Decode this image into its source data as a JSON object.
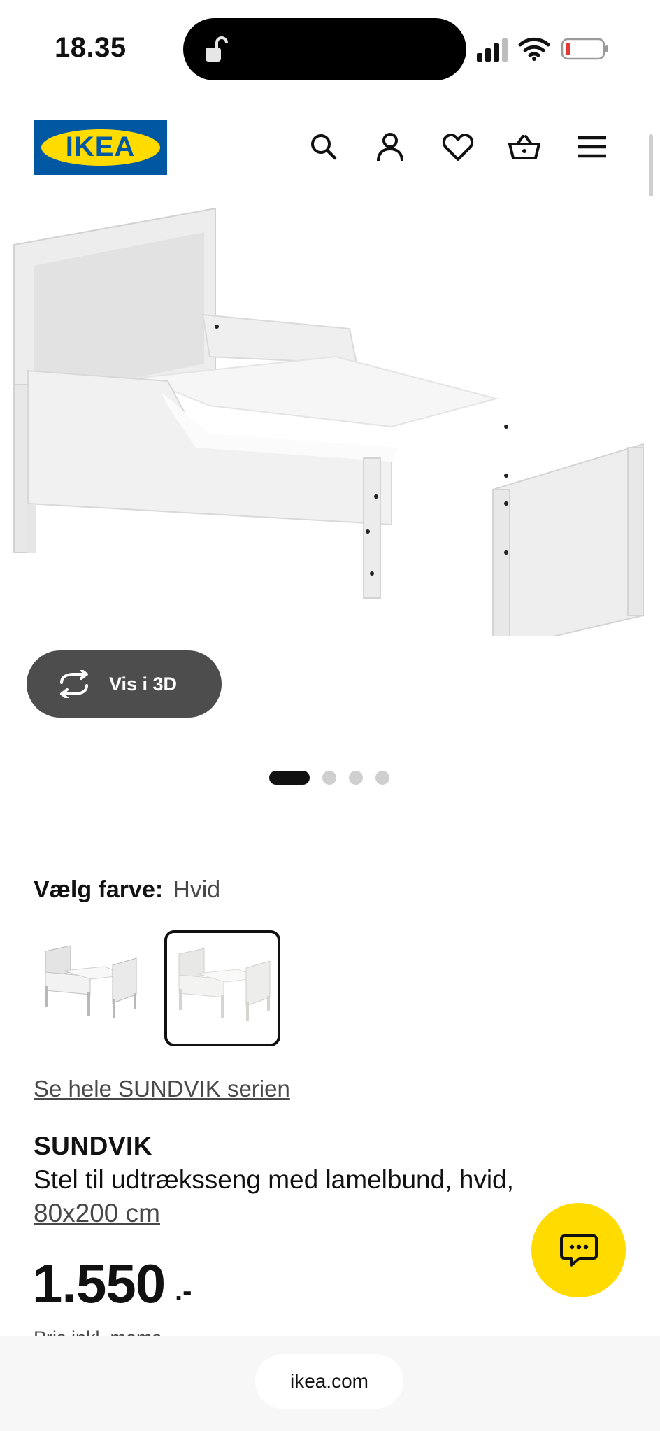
{
  "status_bar": {
    "time": "18.35",
    "icons": [
      "lock-icon",
      "signal-icon",
      "wifi-icon",
      "battery-icon"
    ]
  },
  "header": {
    "logo_text": "IKEA",
    "icons": [
      "search-icon",
      "user-icon",
      "heart-icon",
      "basket-icon",
      "menu-icon"
    ]
  },
  "product": {
    "view_3d_label": "Vis i 3D",
    "carousel": {
      "total": 4,
      "active": 1
    },
    "color_label": "Vælg farve:",
    "color_value": "Hvid",
    "series_link": "Se hele SUNDVIK serien",
    "name": "SUNDVIK",
    "description": "Stel til udtræksseng med lamelbund, hvid,",
    "size": "80x200 cm",
    "price": "1.550",
    "price_suffix": ".-",
    "price_note": "Pris inkl. moms"
  },
  "chat": {
    "icon": "chat-icon"
  },
  "browser": {
    "url": "ikea.com"
  },
  "colors": {
    "ikea_blue": "#0058a3",
    "ikea_yellow": "#ffdb00",
    "button_dark": "#4d4d4d"
  }
}
